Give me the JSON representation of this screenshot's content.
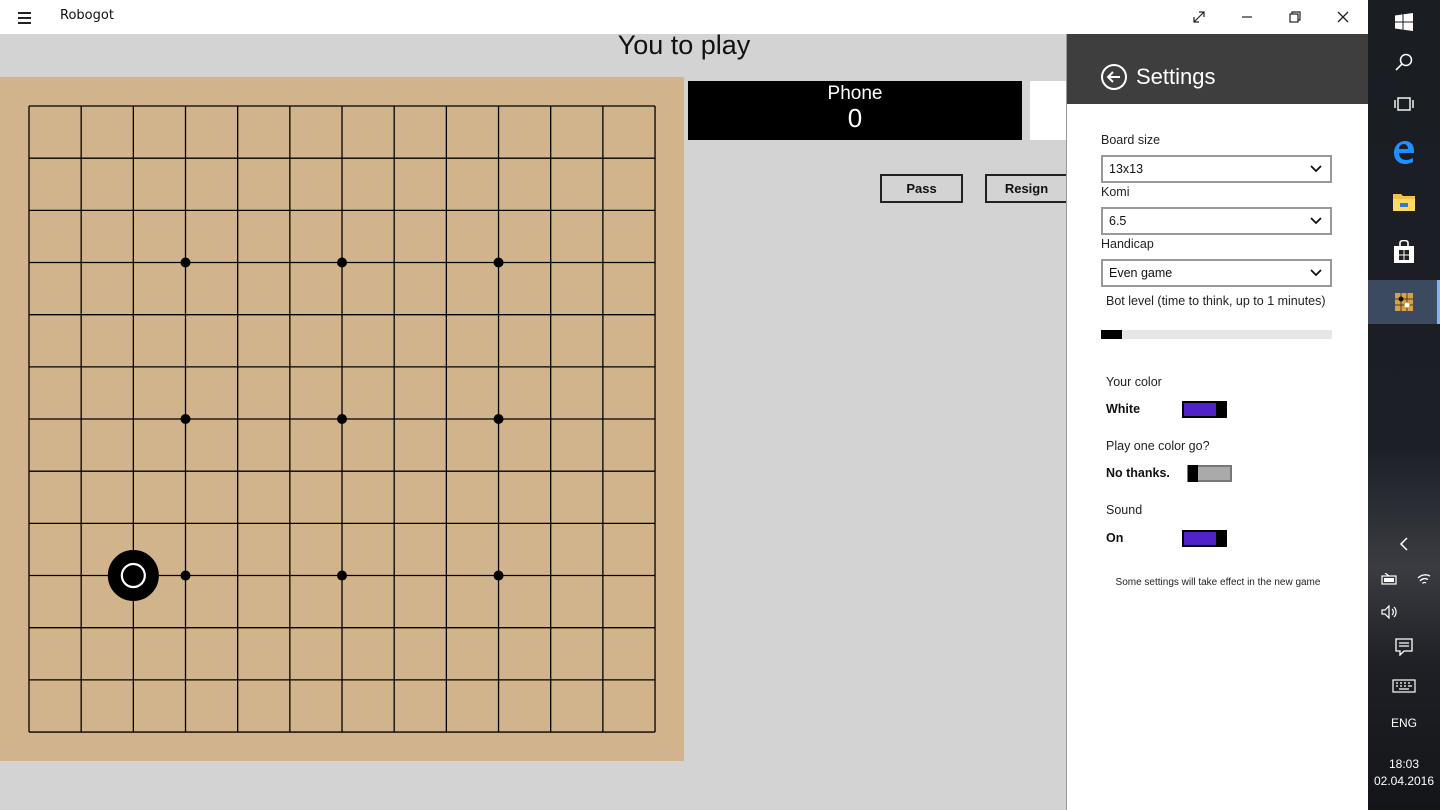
{
  "window": {
    "title": "Robogot",
    "icons": [
      "hamburger-icon",
      "fullscreen-icon",
      "minimize-icon",
      "restore-icon",
      "close-icon"
    ]
  },
  "game": {
    "status": "You to play",
    "board_size": 13,
    "star_points": [
      [
        3,
        3
      ],
      [
        6,
        3
      ],
      [
        9,
        3
      ],
      [
        3,
        6
      ],
      [
        6,
        6
      ],
      [
        9,
        6
      ],
      [
        3,
        9
      ],
      [
        6,
        9
      ],
      [
        9,
        9
      ]
    ],
    "stones": [
      {
        "col": 2,
        "row": 9,
        "color": "black",
        "last_move": true
      }
    ],
    "board_color": "#d2b48c",
    "players": {
      "phone": {
        "name": "Phone",
        "score": "0"
      }
    },
    "buttons": {
      "pass": "Pass",
      "resign": "Resign"
    }
  },
  "settings": {
    "title": "Settings",
    "board_size": {
      "label": "Board size",
      "value": "13x13"
    },
    "komi": {
      "label": "Komi",
      "value": "6.5"
    },
    "handicap": {
      "label": "Handicap",
      "value": "Even game"
    },
    "bot_level": {
      "label": "Bot level (time to think, up to 1 minutes)",
      "value": 0.09
    },
    "your_color": {
      "label": "Your color",
      "state": "White",
      "on": true
    },
    "one_color": {
      "label": "Play one color go?",
      "state": "No thanks.",
      "on": false
    },
    "sound": {
      "label": "Sound",
      "state": "On",
      "on": true
    },
    "note": "Some settings will take effect in the new game",
    "toggle_color": "#5022c8"
  },
  "taskbar": {
    "icons": [
      "windows-start-icon",
      "search-icon",
      "task-view-icon",
      "edge-icon",
      "file-explorer-icon",
      "store-icon",
      "robogot-app-icon",
      "chevron-left-icon",
      "battery-icon",
      "wifi-icon",
      "volume-icon",
      "action-center-icon",
      "keyboard-icon"
    ],
    "language": "ENG",
    "time": "18:03",
    "date": "02.04.2016"
  }
}
